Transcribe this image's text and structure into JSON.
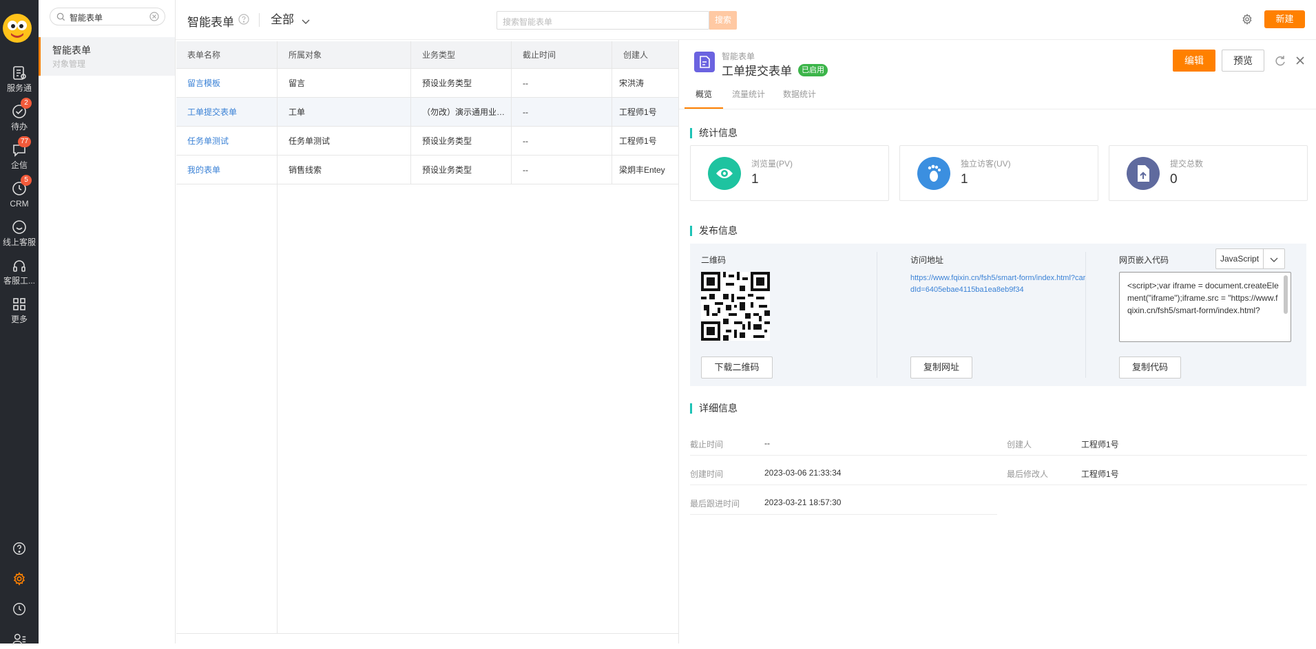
{
  "rail": {
    "items": [
      {
        "label": "服务通"
      },
      {
        "label": "待办",
        "badge": "2"
      },
      {
        "label": "企信",
        "badge": "77"
      },
      {
        "label": "CRM",
        "badge": "5"
      },
      {
        "label": "线上客服"
      },
      {
        "label": "客服工..."
      },
      {
        "label": "更多"
      }
    ]
  },
  "nav": {
    "search_value": "智能表单",
    "item_title": "智能表单",
    "item_subtitle": "对象管理"
  },
  "header": {
    "title": "智能表单",
    "filter": "全部",
    "search_placeholder": "搜索智能表单",
    "search_button": "搜索",
    "new_button": "新建"
  },
  "table": {
    "columns": [
      "表单名称",
      "所属对象",
      "业务类型",
      "截止时间",
      "创建人"
    ],
    "rows": [
      [
        "留言模板",
        "留言",
        "预设业务类型",
        "--",
        "宋洪涛"
      ],
      [
        "工单提交表单",
        "工单",
        "（勿改）演示通用业务类型",
        "--",
        "工程师1号"
      ],
      [
        "任务单测试",
        "任务单测试",
        "预设业务类型",
        "--",
        "工程师1号"
      ],
      [
        "我的表单",
        "销售线索",
        "预设业务类型",
        "--",
        "梁炯丰Entey"
      ]
    ]
  },
  "detail": {
    "subtitle": "智能表单",
    "title": "工单提交表单",
    "status": "已启用",
    "edit_button": "编辑",
    "preview_button": "预览",
    "tabs": [
      "概览",
      "流量统计",
      "数据统计"
    ],
    "stats_title": "统计信息",
    "stats": [
      {
        "label": "浏览量(PV)",
        "value": "1",
        "color": "#1ec3a0"
      },
      {
        "label": "独立访客(UV)",
        "value": "1",
        "color": "#3b8fe0"
      },
      {
        "label": "提交总数",
        "value": "0",
        "color": "#5f6a9e"
      }
    ],
    "publish_title": "发布信息",
    "qr_label": "二维码",
    "qr_button": "下载二维码",
    "url_label": "访问地址",
    "url": "https://www.fqixin.cn/fsh5/smart-form/index.html?cardId=6405ebae4115ba1ea8eb9f34",
    "url_button": "复制网址",
    "embed_label": "网页嵌入代码",
    "embed_lang": "JavaScript",
    "embed_code": "<script>;var iframe = document.createElement(\"iframe\");iframe.src = \"https://www.fqixin.cn/fsh5/smart-form/index.html?",
    "embed_button": "复制代码",
    "details_title": "详细信息",
    "fields": [
      {
        "label": "截止时间",
        "value": "--"
      },
      {
        "label": "创建人",
        "value": "工程师1号"
      },
      {
        "label": "创建时间",
        "value": "2023-03-06 21:33:34"
      },
      {
        "label": "最后修改人",
        "value": "工程师1号"
      },
      {
        "label": "最后跟进时间",
        "value": "2023-03-21 18:57:30"
      }
    ]
  }
}
